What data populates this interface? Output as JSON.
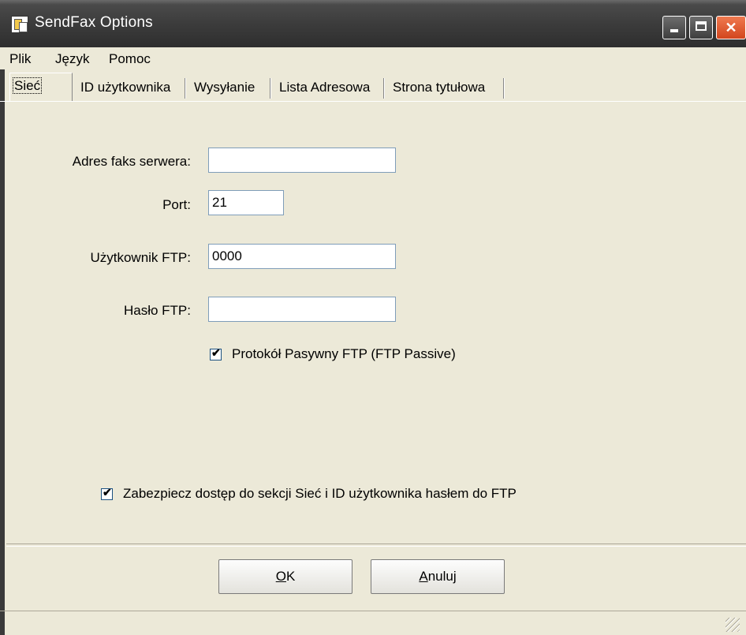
{
  "window": {
    "title": "SendFax Options"
  },
  "menubar": {
    "items": [
      "Plik",
      "Język",
      "Pomoc"
    ]
  },
  "tabs": [
    {
      "label": "Sieć",
      "active": true
    },
    {
      "label": "ID użytkownika",
      "active": false
    },
    {
      "label": "Wysyłanie",
      "active": false
    },
    {
      "label": "Lista Adresowa",
      "active": false
    },
    {
      "label": "Strona tytułowa",
      "active": false
    }
  ],
  "form": {
    "server_address": {
      "label": "Adres faks serwera:",
      "value": ""
    },
    "port": {
      "label": "Port:",
      "value": "21"
    },
    "ftp_user": {
      "label": "Użytkownik FTP:",
      "value": "0000"
    },
    "ftp_password": {
      "label": "Hasło FTP:",
      "value": ""
    },
    "passive": {
      "label": "Protokół Pasywny FTP (FTP Passive)",
      "checked": true
    },
    "protect": {
      "label": "Zabezpiecz dostęp do sekcji Sieć i ID użytkownika hasłem do FTP",
      "checked": true
    }
  },
  "buttons": {
    "ok": {
      "mnemonic": "O",
      "rest": "K"
    },
    "cancel": {
      "mnemonic": "A",
      "rest": "nuluj"
    }
  }
}
